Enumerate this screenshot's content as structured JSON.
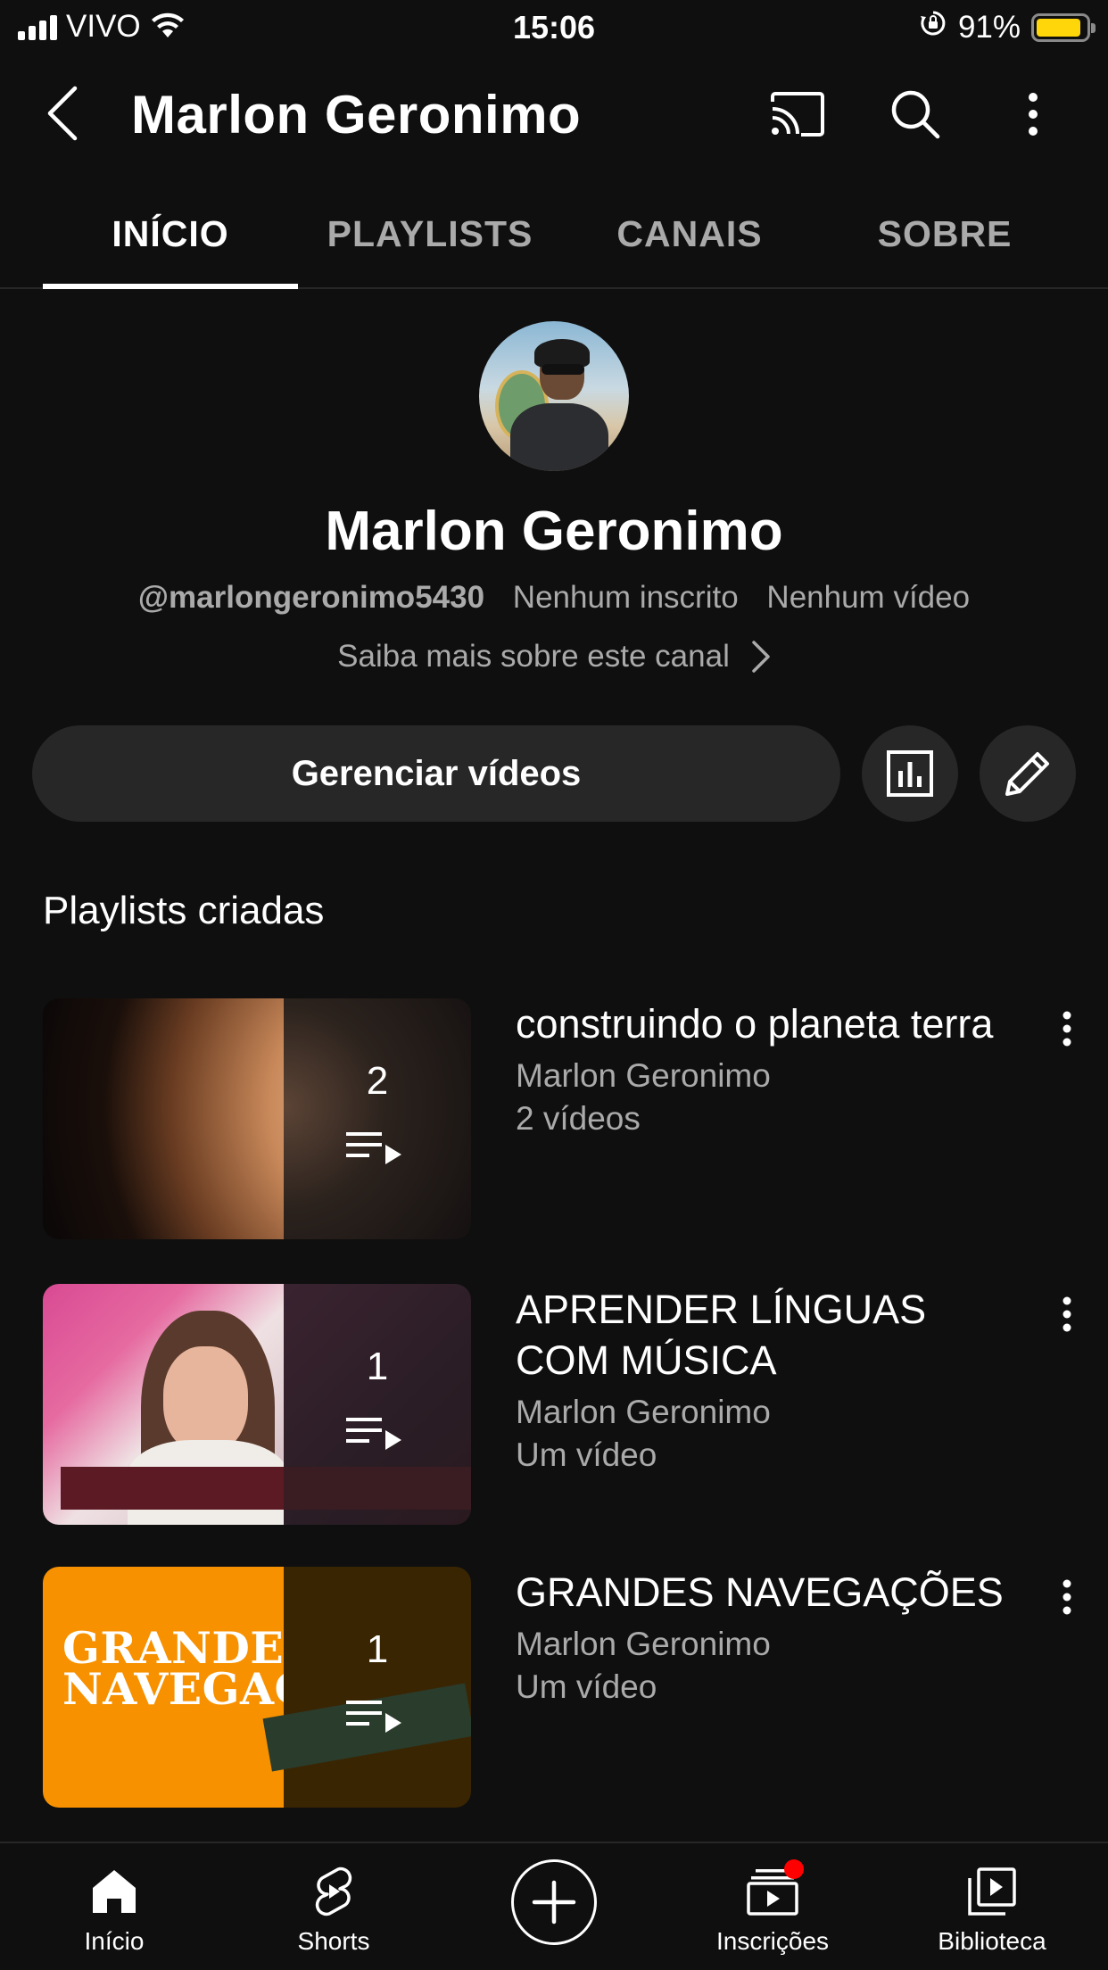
{
  "status_bar": {
    "carrier": "VIVO",
    "time": "15:06",
    "battery_percent": "91%",
    "battery_level": 0.91,
    "battery_color": "#ffd60a"
  },
  "app_bar": {
    "title": "Marlon Geronimo",
    "icons": [
      "back-icon",
      "cast-icon",
      "search-icon",
      "more-vertical-icon"
    ]
  },
  "tabs": [
    {
      "label": "INÍCIO",
      "active": true
    },
    {
      "label": "PLAYLISTS",
      "active": false
    },
    {
      "label": "CANAIS",
      "active": false
    },
    {
      "label": "SOBRE",
      "active": false
    }
  ],
  "profile": {
    "name": "Marlon Geronimo",
    "handle": "@marlongeronimo5430",
    "subscribers": "Nenhum inscrito",
    "videos": "Nenhum vídeo",
    "about_link": "Saiba mais sobre este canal"
  },
  "actions": {
    "manage_label": "Gerenciar vídeos",
    "analytics_icon": "analytics-icon",
    "edit_icon": "pencil-icon"
  },
  "section": {
    "title": "Playlists criadas"
  },
  "playlists": [
    {
      "count": "2",
      "title": "construindo o planeta terra",
      "author": "Marlon Geronimo",
      "videos": "2 vídeos"
    },
    {
      "count": "1",
      "title": "APRENDER LÍNGUAS COM MÚSICA",
      "author": "Marlon Geronimo",
      "videos": "Um vídeo"
    },
    {
      "count": "1",
      "title": "GRANDES NAVEGAÇÕES",
      "author": "Marlon Geronimo",
      "videos": "Um vídeo",
      "thumb_text": "GRANDES NAVEGAÇÕES"
    }
  ],
  "bottom_nav": [
    {
      "label": "Início",
      "icon": "home-icon"
    },
    {
      "label": "Shorts",
      "icon": "shorts-icon"
    },
    {
      "label": "",
      "icon": "create-icon"
    },
    {
      "label": "Inscrições",
      "icon": "subscriptions-icon"
    },
    {
      "label": "Biblioteca",
      "icon": "library-icon"
    }
  ],
  "colors": {
    "background": "#0f0f0f",
    "surface": "#272727",
    "secondary_text": "#aaaaaa",
    "notification": "#ff0000"
  }
}
